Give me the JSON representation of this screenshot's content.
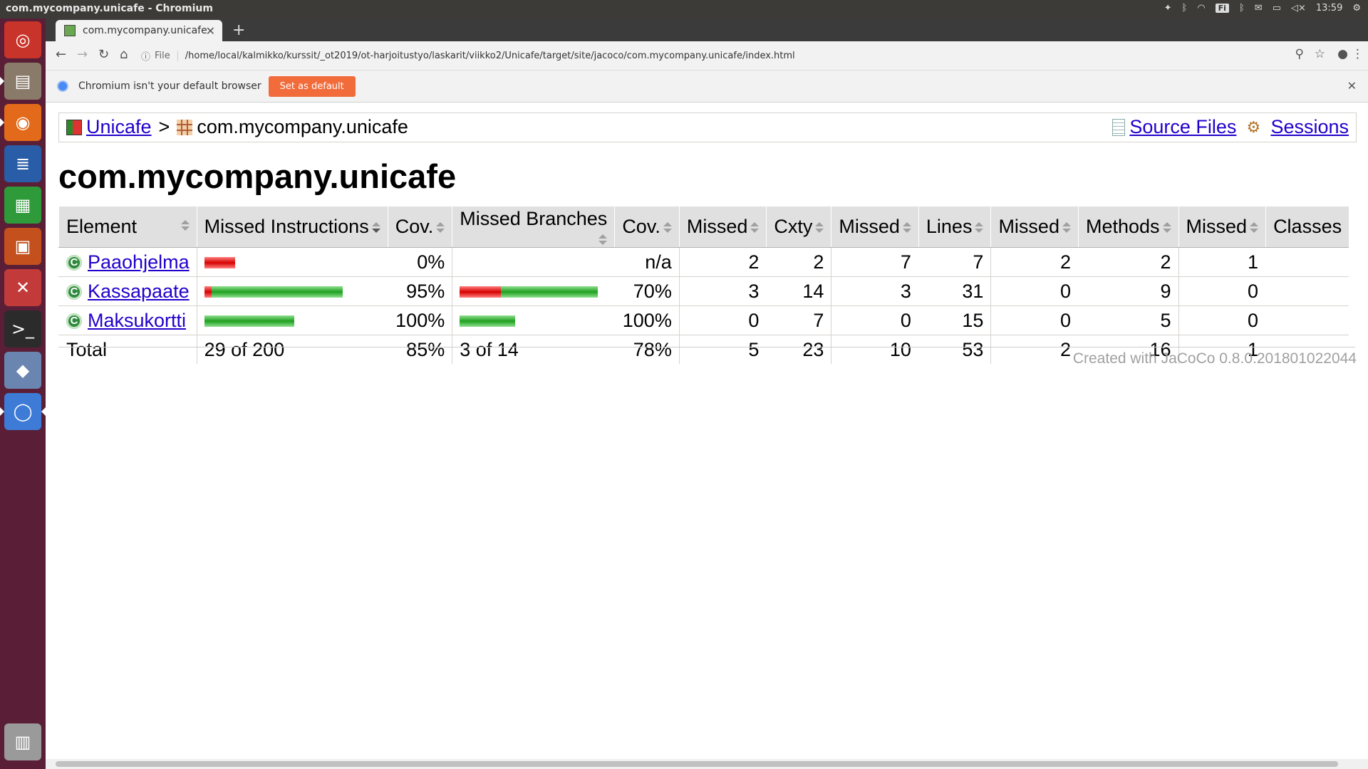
{
  "window_title": "com.mycompany.unicafe - Chromium",
  "panel": {
    "keyboard": "Fi",
    "time": "13:59"
  },
  "tab": {
    "title": "com.mycompany.unicafe"
  },
  "address": {
    "scheme": "File",
    "url": "/home/local/kalmikko/kurssit/_ot2019/ot-harjoitustyo/laskarit/viikko2/Unicafe/target/site/jacoco/com.mycompany.unicafe/index.html"
  },
  "infobar": {
    "message": "Chromium isn't your default browser",
    "button": "Set as default"
  },
  "breadcrumb": {
    "root": "Unicafe",
    "sep": ">",
    "current": "com.mycompany.unicafe",
    "source_files": "Source Files",
    "sessions": "Sessions"
  },
  "page_title": "com.mycompany.unicafe",
  "table": {
    "headers": [
      "Element",
      "Missed Instructions",
      "Cov.",
      "Missed Branches",
      "Cov.",
      "Missed",
      "Cxty",
      "Missed",
      "Lines",
      "Missed",
      "Methods",
      "Missed",
      "Classes"
    ],
    "rows": [
      {
        "name": "Paaohjelma",
        "instr_missed_frac": 1.0,
        "instr_bar_scale": 0.22,
        "instr_cov": "0%",
        "branch_cov": "n/a",
        "branch_missed_frac": null,
        "branch_bar_scale": 0,
        "cxty_missed": "2",
        "cxty": "2",
        "lines_missed": "7",
        "lines": "7",
        "methods_missed": "2",
        "methods": "2",
        "classes_missed": "1"
      },
      {
        "name": "Kassapaate",
        "instr_missed_frac": 0.05,
        "instr_bar_scale": 1.0,
        "instr_cov": "95%",
        "branch_cov": "70%",
        "branch_missed_frac": 0.3,
        "branch_bar_scale": 1.0,
        "cxty_missed": "3",
        "cxty": "14",
        "lines_missed": "3",
        "lines": "31",
        "methods_missed": "0",
        "methods": "9",
        "classes_missed": "0"
      },
      {
        "name": "Maksukortti",
        "instr_missed_frac": 0.0,
        "instr_bar_scale": 0.65,
        "instr_cov": "100%",
        "branch_cov": "100%",
        "branch_missed_frac": 0.0,
        "branch_bar_scale": 0.4,
        "cxty_missed": "0",
        "cxty": "7",
        "lines_missed": "0",
        "lines": "15",
        "methods_missed": "0",
        "methods": "5",
        "classes_missed": "0"
      }
    ],
    "total": {
      "label": "Total",
      "instr": "29 of 200",
      "instr_cov": "85%",
      "branch": "3 of 14",
      "branch_cov": "78%",
      "cxty_missed": "5",
      "cxty": "23",
      "lines_missed": "10",
      "lines": "53",
      "methods_missed": "2",
      "methods": "16",
      "classes_missed": "1"
    }
  },
  "footer": {
    "prefix": "Created with",
    "link": "JaCoCo",
    "version": "0.8.0.201801022044"
  },
  "colors": {
    "missed_bar": "#d60000",
    "covered_bar": "#1fa01f",
    "header_bg": "#e0e0e0",
    "link": "#2200cc"
  }
}
